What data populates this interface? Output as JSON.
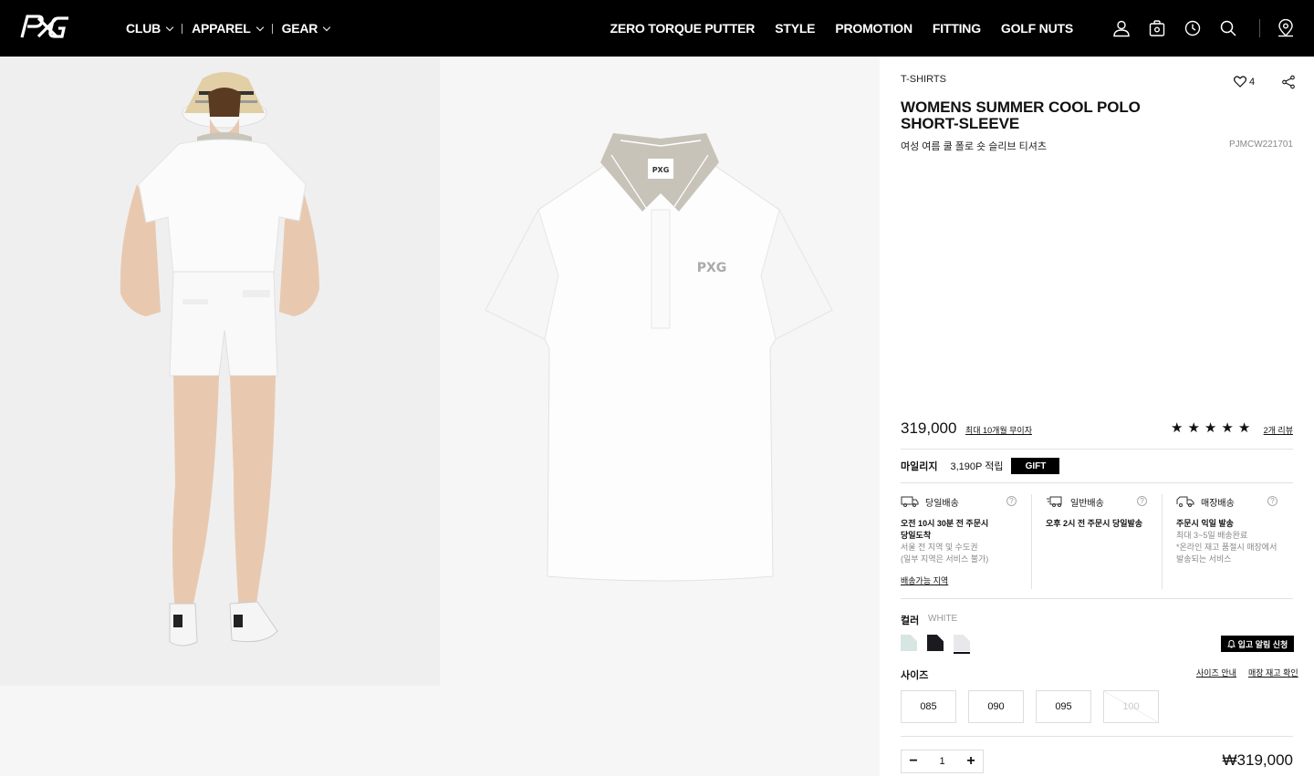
{
  "brand": {
    "logo_text": "PXG"
  },
  "nav": {
    "categories": [
      {
        "label": "CLUB"
      },
      {
        "label": "APPAREL"
      },
      {
        "label": "GEAR"
      }
    ],
    "main": [
      "ZERO TORQUE PUTTER",
      "STYLE",
      "PROMOTION",
      "FITTING",
      "GOLF NUTS"
    ],
    "icons": [
      "user-icon",
      "bag-icon",
      "history-icon",
      "search-icon",
      "store-locator-icon"
    ]
  },
  "product": {
    "category": "T-SHIRTS",
    "likes": "4",
    "title": "WOMENS SUMMER COOL POLO SHORT-SLEEVE",
    "subtitle": "여성 여름 쿨 폴로 숏 슬리브 티셔츠",
    "code": "PJMCW221701",
    "price": "319,000",
    "installment": "최대 10개월 무이자",
    "rating": 5,
    "reviews": "2개 리뷰",
    "mileage_label": "마일리지",
    "mileage_value": "3,190P 적립",
    "gift_label": "GIFT"
  },
  "shipping": [
    {
      "title": "당일배송",
      "bold1": "오전 10시 30분 전 주문시",
      "bold2": "당일도착",
      "gray1": "서울 전 지역 및 수도권",
      "gray2": "(일부 지역은 서비스 불가)",
      "link": "배송가능 지역"
    },
    {
      "title": "일반배송",
      "bold1": "오후 2시 전 주문시 당일발송",
      "bold2": "",
      "gray1": "",
      "gray2": "",
      "link": ""
    },
    {
      "title": "매장배송",
      "bold1": "주문시 익일 발송",
      "bold2": "",
      "gray1": "최대 3~5일 배송완료",
      "gray2": "*온라인 재고 품절시 매장에서 발송되는 서비스",
      "link": ""
    }
  ],
  "color": {
    "label": "컬러",
    "selected": "WHITE",
    "swatches": [
      "#d6e6e2",
      "#1a1a1f",
      "#e8e8ec"
    ],
    "restock_label": "입고 알림 신청"
  },
  "size": {
    "label": "사이즈",
    "guide_label": "사이즈 안내",
    "stock_label": "매장 재고 확인",
    "options": [
      {
        "label": "085",
        "sold_out": false
      },
      {
        "label": "090",
        "sold_out": false
      },
      {
        "label": "095",
        "sold_out": false
      },
      {
        "label": "100",
        "sold_out": true
      }
    ]
  },
  "order": {
    "quantity": "1",
    "total": "₩319,000"
  }
}
